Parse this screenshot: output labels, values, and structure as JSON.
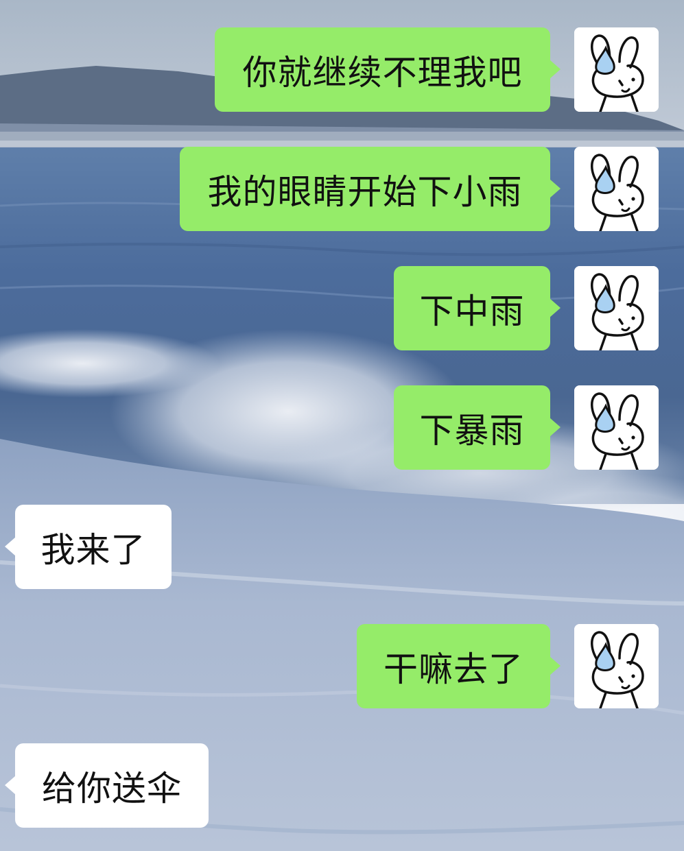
{
  "chat": {
    "messages": [
      {
        "sender": "me",
        "text": "你就继续不理我吧"
      },
      {
        "sender": "me",
        "text": "我的眼睛开始下小雨"
      },
      {
        "sender": "me",
        "text": "下中雨"
      },
      {
        "sender": "me",
        "text": "下暴雨"
      },
      {
        "sender": "other",
        "text": "我来了"
      },
      {
        "sender": "me",
        "text": "干嘛去了"
      },
      {
        "sender": "other",
        "text": "给你送伞"
      }
    ]
  },
  "colors": {
    "my_bubble": "#95ec69",
    "other_bubble": "#ffffff",
    "text": "#111111",
    "teardrop": "#a9d1f2"
  },
  "avatar": {
    "icon": "crying-bunny-icon"
  },
  "background": {
    "icon": "ocean-beach-wave-scene"
  }
}
